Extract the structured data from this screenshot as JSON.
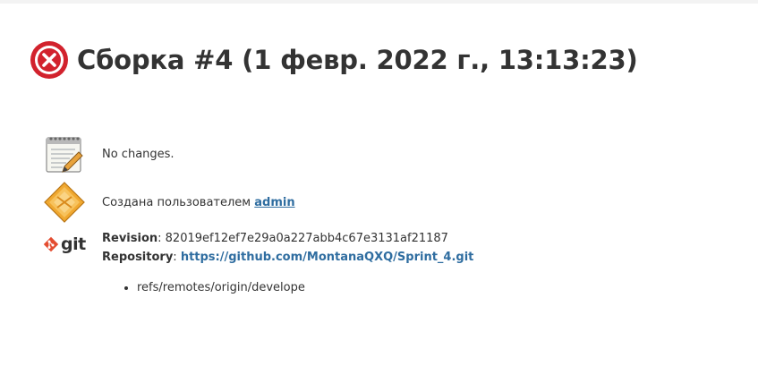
{
  "build": {
    "title": "Сборка #4 (1 февр. 2022 г., 13:13:23)",
    "status": "failed",
    "status_color": "#d2222d"
  },
  "changes": {
    "text": "No changes.",
    "icon": "notepad-icon"
  },
  "cause": {
    "prefix": "Создана пользователем",
    "user": "admin",
    "icon": "user-cause-icon"
  },
  "git": {
    "logo_text": "git",
    "revision_label": "Revision",
    "revision": "82019ef12ef7e29a0a227abb4c67e3131af21187",
    "repository_label": "Repository",
    "repository": "https://github.com/MontanaQXQ/Sprint_4.git",
    "branches": [
      "refs/remotes/origin/develope"
    ]
  },
  "colors": {
    "link": "#2f6da0",
    "text": "#333333"
  }
}
